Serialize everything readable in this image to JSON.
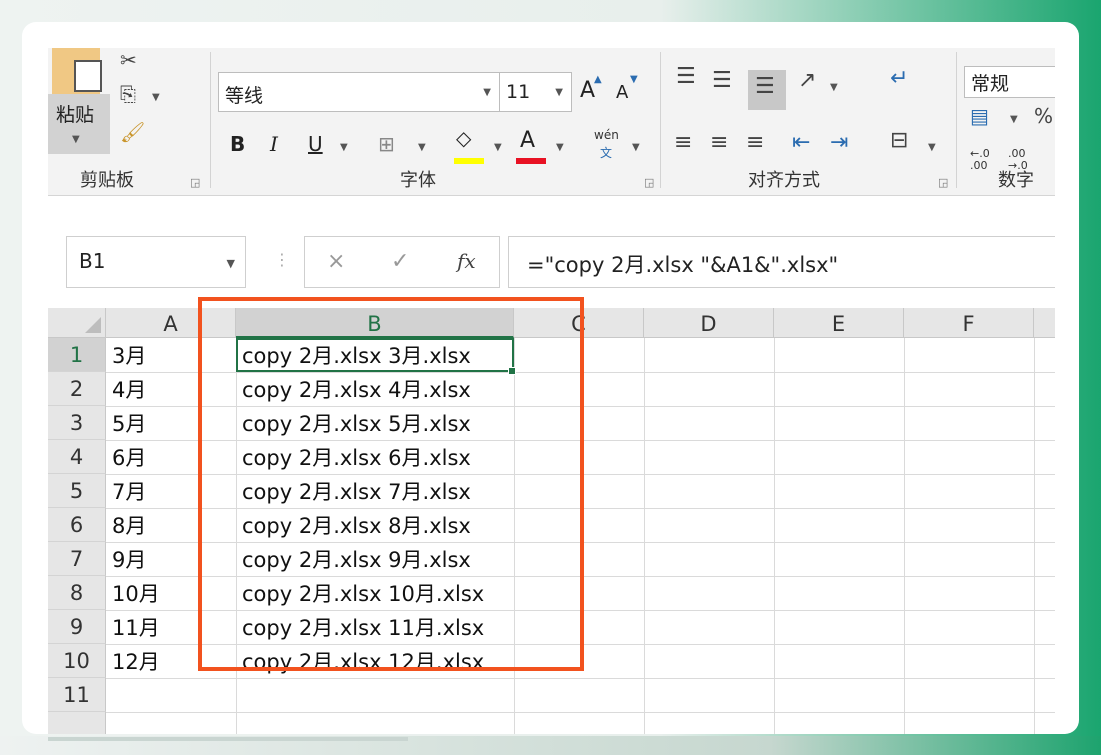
{
  "ribbon": {
    "clipboard": {
      "paste_label": "粘贴",
      "group_label": "剪贴板",
      "icons": [
        "cut-icon",
        "copy-icon",
        "format-painter-icon"
      ]
    },
    "font": {
      "font_name": "等线",
      "font_size": "11",
      "grow_label": "A",
      "shrink_label": "A",
      "bold_label": "B",
      "italic_label": "I",
      "underline_label": "U",
      "font_color_label": "A",
      "phonetic_top": "wén",
      "phonetic_bottom": "文",
      "group_label": "字体",
      "highlight_color": "#ffff00",
      "font_color": "#e81123"
    },
    "alignment": {
      "group_label": "对齐方式"
    },
    "number": {
      "format_value": "常规",
      "percent_label": "%",
      "inc_decimal": "←.0 .00",
      "dec_decimal": ".00 →.0",
      "group_label": "数字"
    }
  },
  "formula_bar": {
    "name_box": "B1",
    "cancel_symbol": "×",
    "enter_symbol": "✓",
    "fx_label": "fx",
    "formula": "=\"copy 2月.xlsx \"&A1&\".xlsx\""
  },
  "sheet": {
    "columns": [
      "A",
      "B",
      "C",
      "D",
      "E",
      "F"
    ],
    "selected_column": "B",
    "row_numbers": [
      "1",
      "2",
      "3",
      "4",
      "5",
      "6",
      "7",
      "8",
      "9",
      "10",
      "11"
    ],
    "col_a": [
      "3月",
      "4月",
      "5月",
      "6月",
      "7月",
      "8月",
      "9月",
      "10月",
      "11月",
      "12月"
    ],
    "col_b": [
      "copy 2月.xlsx 3月.xlsx",
      "copy 2月.xlsx 4月.xlsx",
      "copy 2月.xlsx 5月.xlsx",
      "copy 2月.xlsx 6月.xlsx",
      "copy 2月.xlsx 7月.xlsx",
      "copy 2月.xlsx 8月.xlsx",
      "copy 2月.xlsx 9月.xlsx",
      "copy 2月.xlsx 10月.xlsx",
      "copy 2月.xlsx 11月.xlsx",
      "copy 2月.xlsx 12月.xlsx"
    ],
    "accent_color": "#217346",
    "annotation_color": "#f2521e"
  }
}
